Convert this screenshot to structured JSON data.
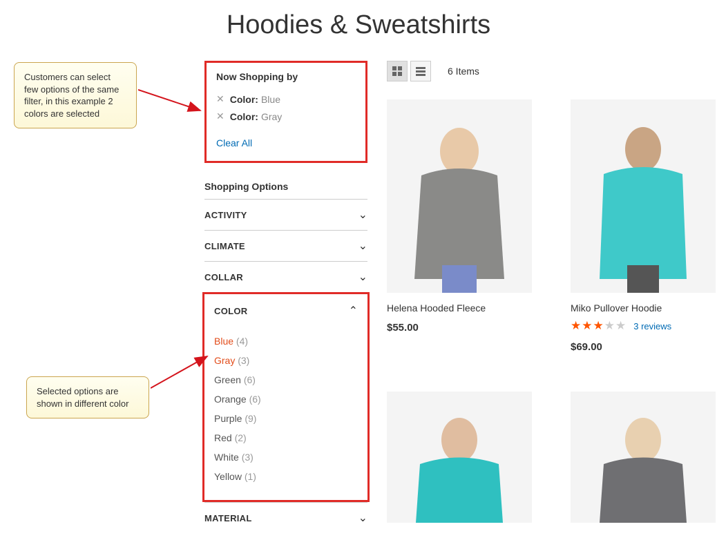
{
  "page_title": "Hoodies & Sweatshirts",
  "callouts": {
    "c1": "Customers can select few options of the same filter, in this example 2 colors are selected",
    "c2": "Selected options are shown in different color"
  },
  "now_shopping": {
    "title": "Now Shopping by",
    "filters": [
      {
        "label": "Color:",
        "value": "Blue"
      },
      {
        "label": "Color:",
        "value": "Gray"
      }
    ],
    "clear_all": "Clear All"
  },
  "shopping_options_title": "Shopping Options",
  "filter_groups": {
    "activity": "ACTIVITY",
    "climate": "CLIMATE",
    "collar": "COLLAR",
    "color": "COLOR",
    "material": "MATERIAL"
  },
  "color_options": [
    {
      "name": "Blue",
      "count": "(4)",
      "selected": true
    },
    {
      "name": "Gray",
      "count": "(3)",
      "selected": true
    },
    {
      "name": "Green",
      "count": "(6)",
      "selected": false
    },
    {
      "name": "Orange",
      "count": "(6)",
      "selected": false
    },
    {
      "name": "Purple",
      "count": "(9)",
      "selected": false
    },
    {
      "name": "Red",
      "count": "(2)",
      "selected": false
    },
    {
      "name": "White",
      "count": "(3)",
      "selected": false
    },
    {
      "name": "Yellow",
      "count": "(1)",
      "selected": false
    }
  ],
  "toolbar": {
    "item_count": "6 Items"
  },
  "products": [
    {
      "name": "Helena Hooded Fleece",
      "price": "$55.00",
      "reviews": null,
      "rating": null
    },
    {
      "name": "Miko Pullover Hoodie",
      "price": "$69.00",
      "reviews": "3 reviews",
      "rating": 3
    }
  ]
}
